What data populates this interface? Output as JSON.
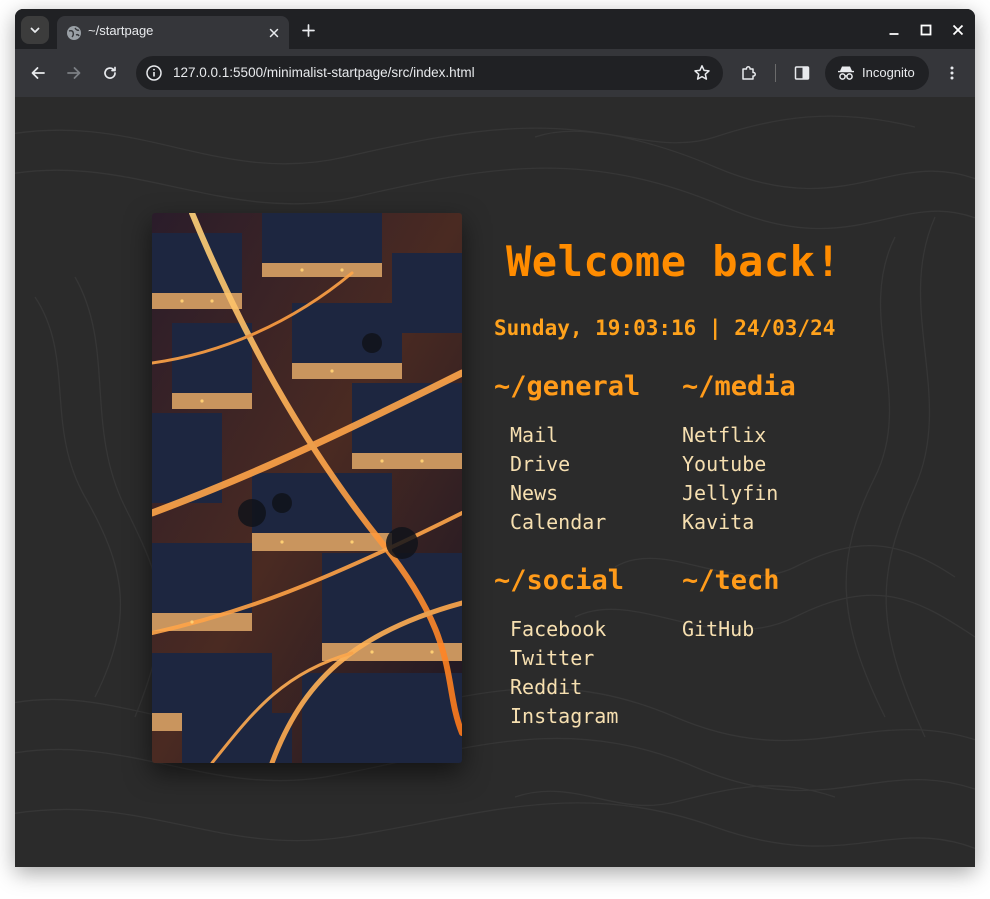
{
  "browser": {
    "tab": {
      "title": "~/startpage",
      "favicon": "globe-icon"
    },
    "address_bar": {
      "url": "127.0.0.1:5500/minimalist-startpage/src/index.html"
    },
    "incognito_label": "Incognito",
    "icons": {
      "tab_search": "chevron-down-icon",
      "tab_close": "close-icon",
      "new_tab": "plus-icon",
      "minimize": "minimize-icon",
      "maximize": "maximize-icon",
      "close_window": "close-icon",
      "back": "back-arrow-icon",
      "forward": "forward-arrow-icon",
      "reload": "reload-icon",
      "site_info": "info-icon",
      "bookmark": "star-icon",
      "extensions": "puzzle-icon",
      "side_panel": "side-panel-icon",
      "incognito": "incognito-icon",
      "menu": "kebab-menu-icon"
    }
  },
  "page": {
    "welcome": "Welcome back!",
    "datetime": "Sunday, 19:03:16 | 24/03/24",
    "colors": {
      "accent": "#ff8c00",
      "link": "#f6dfb0",
      "background": "#2b2b2b"
    },
    "sections": {
      "general": {
        "title": "~/general",
        "links": [
          "Mail",
          "Drive",
          "News",
          "Calendar"
        ]
      },
      "media": {
        "title": "~/media",
        "links": [
          "Netflix",
          "Youtube",
          "Jellyfin",
          "Kavita"
        ]
      },
      "social": {
        "title": "~/social",
        "links": [
          "Facebook",
          "Twitter",
          "Reddit",
          "Instagram"
        ]
      },
      "tech": {
        "title": "~/tech",
        "links": [
          "GitHub"
        ]
      }
    }
  }
}
